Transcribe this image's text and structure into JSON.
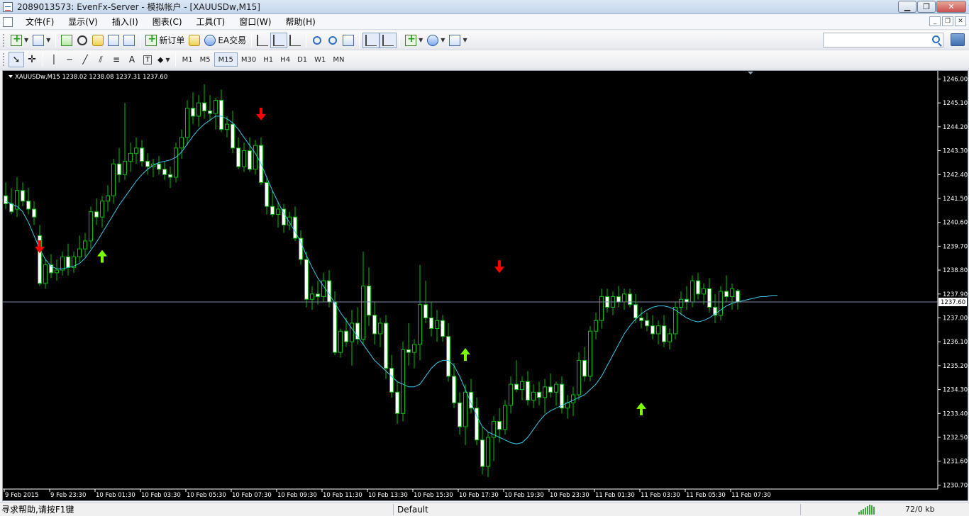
{
  "window": {
    "title": "2089013573: EvenFx-Server - 模拟帐户 - [XAUUSDw,M15]"
  },
  "menu": [
    {
      "label": "文件(F)"
    },
    {
      "label": "显示(V)"
    },
    {
      "label": "插入(I)"
    },
    {
      "label": "图表(C)"
    },
    {
      "label": "工具(T)"
    },
    {
      "label": "窗口(W)"
    },
    {
      "label": "帮助(H)"
    }
  ],
  "toolbar": {
    "new_order_label": "新订单",
    "ea_trading_label": "EA交易",
    "timeframes": [
      "M1",
      "M5",
      "M15",
      "M30",
      "H1",
      "H4",
      "D1",
      "W1",
      "MN"
    ],
    "active_timeframe": "M15",
    "search_placeholder": ""
  },
  "chart": {
    "header": "XAUUSDw,M15  1238.02 1238.08 1237.31 1237.60",
    "current_price_label": "1237.60",
    "colors": {
      "background": "#000000",
      "bull_body": "#000000",
      "bear_body": "#ffffff",
      "wick": "#00c000",
      "ma_line": "#40c8e8",
      "price_line": "#7a8fa8",
      "buy_arrow": "#7cfc00",
      "sell_arrow": "#ff0000",
      "axis_text": "#ffffff"
    },
    "x_labels": [
      "9 Feb 2015",
      "9 Feb 23:30",
      "10 Feb 01:30",
      "10 Feb 03:30",
      "10 Feb 05:30",
      "10 Feb 07:30",
      "10 Feb 09:30",
      "10 Feb 11:30",
      "10 Feb 13:30",
      "10 Feb 15:30",
      "10 Feb 17:30",
      "10 Feb 19:30",
      "10 Feb 23:30",
      "11 Feb 01:30",
      "11 Feb 03:30",
      "11 Feb 05:30",
      "11 Feb 07:30"
    ]
  },
  "chart_data": {
    "type": "candlestick",
    "symbol": "XAUUSDw",
    "timeframe": "M15",
    "last_bar": {
      "open": 1238.02,
      "high": 1238.08,
      "low": 1237.31,
      "close": 1237.6
    },
    "y_ticks": [
      1246.0,
      1245.1,
      1244.2,
      1243.3,
      1242.4,
      1241.5,
      1240.6,
      1239.7,
      1238.8,
      1237.9,
      1237.0,
      1236.1,
      1235.2,
      1234.3,
      1233.4,
      1232.5,
      1231.6,
      1230.7
    ],
    "ylim": [
      1230.55,
      1246.2
    ],
    "current_price": 1237.6,
    "series": [
      {
        "name": "",
        "type": "candles",
        "values": [
          [
            1241.6,
            1242.1,
            1241.1,
            1241.3
          ],
          [
            1241.3,
            1241.9,
            1240.9,
            1241.0
          ],
          [
            1241.1,
            1242.3,
            1240.8,
            1241.8
          ],
          [
            1241.8,
            1242.1,
            1241.2,
            1241.4
          ],
          [
            1241.4,
            1241.9,
            1240.9,
            1241.1
          ],
          [
            1241.1,
            1241.4,
            1240.5,
            1240.8
          ],
          [
            1240.1,
            1240.5,
            1238.2,
            1238.3
          ],
          [
            1238.3,
            1239.2,
            1238.1,
            1239.0
          ],
          [
            1239.0,
            1239.4,
            1238.5,
            1238.7
          ],
          [
            1238.7,
            1239.2,
            1238.4,
            1238.8
          ],
          [
            1238.8,
            1239.5,
            1238.6,
            1239.3
          ],
          [
            1239.3,
            1239.8,
            1238.6,
            1238.9
          ],
          [
            1238.9,
            1239.5,
            1238.7,
            1239.3
          ],
          [
            1239.3,
            1240.1,
            1239.1,
            1239.6
          ],
          [
            1239.6,
            1240.2,
            1239.3,
            1239.9
          ],
          [
            1239.9,
            1241.2,
            1239.6,
            1241.0
          ],
          [
            1241.0,
            1241.5,
            1240.5,
            1240.8
          ],
          [
            1240.8,
            1241.6,
            1240.4,
            1241.4
          ],
          [
            1241.4,
            1242.0,
            1241.0,
            1241.6
          ],
          [
            1241.6,
            1243.0,
            1241.3,
            1242.8
          ],
          [
            1242.8,
            1243.4,
            1242.1,
            1242.4
          ],
          [
            1242.4,
            1245.1,
            1242.2,
            1242.9
          ],
          [
            1242.9,
            1243.6,
            1242.5,
            1243.2
          ],
          [
            1243.2,
            1243.8,
            1242.8,
            1243.4
          ],
          [
            1243.4,
            1243.7,
            1242.7,
            1242.9
          ],
          [
            1242.9,
            1243.2,
            1242.4,
            1242.7
          ],
          [
            1242.7,
            1243.0,
            1242.3,
            1242.8
          ],
          [
            1242.8,
            1243.1,
            1242.4,
            1242.6
          ],
          [
            1242.6,
            1242.9,
            1242.2,
            1242.4
          ],
          [
            1242.4,
            1242.7,
            1241.9,
            1242.3
          ],
          [
            1242.3,
            1243.6,
            1242.1,
            1243.4
          ],
          [
            1243.4,
            1244.1,
            1243.0,
            1243.8
          ],
          [
            1243.8,
            1245.2,
            1243.5,
            1244.9
          ],
          [
            1244.9,
            1245.5,
            1244.3,
            1244.6
          ],
          [
            1244.6,
            1245.4,
            1244.2,
            1245.1
          ],
          [
            1245.1,
            1245.8,
            1244.5,
            1244.8
          ],
          [
            1244.8,
            1245.4,
            1244.4,
            1244.7
          ],
          [
            1244.7,
            1245.3,
            1244.1,
            1245.2
          ],
          [
            1245.2,
            1245.6,
            1244.0,
            1244.1
          ],
          [
            1244.1,
            1244.6,
            1243.8,
            1244.3
          ],
          [
            1244.3,
            1244.8,
            1243.2,
            1243.4
          ],
          [
            1243.4,
            1243.8,
            1242.6,
            1242.7
          ],
          [
            1242.7,
            1243.6,
            1242.5,
            1243.3
          ],
          [
            1243.3,
            1243.8,
            1242.5,
            1242.6
          ],
          [
            1242.6,
            1243.7,
            1242.4,
            1243.5
          ],
          [
            1243.5,
            1243.8,
            1242.0,
            1242.1
          ],
          [
            1242.1,
            1242.3,
            1240.9,
            1241.2
          ],
          [
            1241.2,
            1241.8,
            1240.8,
            1240.9
          ],
          [
            1240.9,
            1241.4,
            1240.4,
            1241.1
          ],
          [
            1241.1,
            1241.3,
            1240.2,
            1240.5
          ],
          [
            1240.5,
            1241.0,
            1240.3,
            1240.8
          ],
          [
            1240.8,
            1241.2,
            1239.9,
            1240.0
          ],
          [
            1240.0,
            1240.3,
            1239.0,
            1239.2
          ],
          [
            1239.2,
            1239.5,
            1237.4,
            1237.7
          ],
          [
            1237.7,
            1238.2,
            1237.3,
            1237.9
          ],
          [
            1237.9,
            1238.4,
            1237.5,
            1237.8
          ],
          [
            1237.8,
            1238.7,
            1237.6,
            1238.4
          ],
          [
            1238.4,
            1238.8,
            1237.4,
            1237.6
          ],
          [
            1237.6,
            1238.0,
            1235.6,
            1235.7
          ],
          [
            1235.7,
            1236.6,
            1235.5,
            1236.5
          ],
          [
            1236.5,
            1237.0,
            1235.9,
            1236.1
          ],
          [
            1236.1,
            1237.3,
            1235.2,
            1236.8
          ],
          [
            1236.8,
            1237.4,
            1236.0,
            1236.2
          ],
          [
            1236.2,
            1239.5,
            1236.0,
            1238.2
          ],
          [
            1238.2,
            1238.9,
            1236.7,
            1237.1
          ],
          [
            1237.1,
            1237.6,
            1236.0,
            1236.4
          ],
          [
            1236.4,
            1237.0,
            1235.9,
            1236.8
          ],
          [
            1236.8,
            1237.1,
            1234.7,
            1235.1
          ],
          [
            1235.1,
            1235.6,
            1234.0,
            1234.2
          ],
          [
            1234.2,
            1234.6,
            1233.0,
            1233.4
          ],
          [
            1233.4,
            1236.1,
            1233.1,
            1235.8
          ],
          [
            1235.8,
            1236.8,
            1235.2,
            1235.7
          ],
          [
            1235.7,
            1236.2,
            1235.1,
            1236.0
          ],
          [
            1236.0,
            1239.0,
            1235.4,
            1237.5
          ],
          [
            1237.5,
            1238.4,
            1236.8,
            1237.0
          ],
          [
            1237.0,
            1237.6,
            1236.3,
            1236.6
          ],
          [
            1236.6,
            1237.3,
            1236.1,
            1236.9
          ],
          [
            1236.9,
            1237.1,
            1236.1,
            1236.3
          ],
          [
            1236.3,
            1236.8,
            1234.6,
            1234.8
          ],
          [
            1234.8,
            1235.3,
            1233.6,
            1233.8
          ],
          [
            1233.8,
            1234.2,
            1232.6,
            1232.9
          ],
          [
            1232.9,
            1234.5,
            1232.2,
            1234.2
          ],
          [
            1234.2,
            1234.7,
            1233.4,
            1233.6
          ],
          [
            1233.6,
            1234.0,
            1232.2,
            1232.4
          ],
          [
            1232.4,
            1232.9,
            1231.1,
            1231.4
          ],
          [
            1231.4,
            1232.7,
            1231.0,
            1232.5
          ],
          [
            1232.5,
            1233.3,
            1231.6,
            1233.1
          ],
          [
            1233.1,
            1233.6,
            1232.3,
            1232.8
          ],
          [
            1232.8,
            1233.9,
            1232.6,
            1233.7
          ],
          [
            1233.7,
            1234.8,
            1233.4,
            1234.5
          ],
          [
            1234.5,
            1235.4,
            1234.2,
            1234.3
          ],
          [
            1234.3,
            1234.8,
            1233.9,
            1234.6
          ],
          [
            1234.6,
            1235.0,
            1233.7,
            1233.9
          ],
          [
            1233.9,
            1234.5,
            1233.6,
            1234.2
          ],
          [
            1234.2,
            1234.6,
            1233.7,
            1234.0
          ],
          [
            1234.0,
            1234.7,
            1233.4,
            1234.4
          ],
          [
            1234.4,
            1234.9,
            1234.0,
            1234.2
          ],
          [
            1234.2,
            1234.6,
            1233.7,
            1234.5
          ],
          [
            1234.5,
            1234.8,
            1233.4,
            1233.6
          ],
          [
            1233.6,
            1234.1,
            1233.2,
            1233.8
          ],
          [
            1233.8,
            1234.4,
            1233.3,
            1234.1
          ],
          [
            1234.1,
            1235.7,
            1233.9,
            1235.4
          ],
          [
            1235.4,
            1235.9,
            1234.6,
            1234.8
          ],
          [
            1234.8,
            1236.7,
            1234.6,
            1236.5
          ],
          [
            1236.5,
            1237.2,
            1236.2,
            1236.9
          ],
          [
            1236.9,
            1238.1,
            1236.6,
            1237.8
          ],
          [
            1237.8,
            1238.1,
            1237.2,
            1237.4
          ],
          [
            1237.4,
            1238.0,
            1237.1,
            1237.8
          ],
          [
            1237.8,
            1238.2,
            1237.4,
            1237.6
          ],
          [
            1237.6,
            1238.1,
            1237.3,
            1237.9
          ],
          [
            1237.9,
            1238.1,
            1237.4,
            1237.5
          ],
          [
            1237.5,
            1237.9,
            1236.8,
            1237.0
          ],
          [
            1237.0,
            1237.4,
            1236.6,
            1236.9
          ],
          [
            1236.9,
            1237.2,
            1236.5,
            1236.7
          ],
          [
            1236.7,
            1237.1,
            1236.2,
            1236.4
          ],
          [
            1236.4,
            1236.9,
            1236.0,
            1236.7
          ],
          [
            1236.7,
            1237.1,
            1235.9,
            1236.1
          ],
          [
            1236.1,
            1236.6,
            1235.8,
            1236.4
          ],
          [
            1236.4,
            1237.6,
            1236.2,
            1237.4
          ],
          [
            1237.4,
            1238.0,
            1237.1,
            1237.7
          ],
          [
            1237.7,
            1238.2,
            1237.3,
            1237.6
          ],
          [
            1237.6,
            1238.6,
            1237.4,
            1238.4
          ],
          [
            1238.4,
            1238.7,
            1237.7,
            1237.9
          ],
          [
            1237.9,
            1238.3,
            1237.5,
            1238.1
          ],
          [
            1238.1,
            1238.5,
            1237.2,
            1237.4
          ],
          [
            1237.4,
            1237.9,
            1236.8,
            1237.1
          ],
          [
            1237.1,
            1238.2,
            1236.9,
            1238.0
          ],
          [
            1238.0,
            1238.6,
            1237.6,
            1237.8
          ],
          [
            1237.8,
            1238.3,
            1237.3,
            1238.1
          ],
          [
            1238.02,
            1238.08,
            1237.31,
            1237.6
          ]
        ]
      },
      {
        "name": "",
        "type": "line",
        "values": [
          1241.4,
          1241.3,
          1241.2,
          1241.0,
          1240.6,
          1240.1,
          1239.6,
          1239.2,
          1238.95,
          1238.85,
          1238.85,
          1238.9,
          1238.95,
          1239.05,
          1239.25,
          1239.55,
          1239.85,
          1240.2,
          1240.55,
          1240.9,
          1241.25,
          1241.55,
          1241.85,
          1242.15,
          1242.4,
          1242.6,
          1242.75,
          1242.85,
          1242.9,
          1242.95,
          1243.05,
          1243.25,
          1243.55,
          1243.85,
          1244.1,
          1244.3,
          1244.45,
          1244.6,
          1244.6,
          1244.5,
          1244.35,
          1244.1,
          1243.8,
          1243.5,
          1243.2,
          1242.8,
          1242.3,
          1241.8,
          1241.35,
          1240.95,
          1240.6,
          1240.25,
          1239.85,
          1239.35,
          1238.9,
          1238.5,
          1238.2,
          1237.9,
          1237.55,
          1237.2,
          1236.9,
          1236.6,
          1236.3,
          1236.0,
          1235.7,
          1235.4,
          1235.2,
          1235.0,
          1234.8,
          1234.6,
          1234.5,
          1234.4,
          1234.4,
          1234.5,
          1234.8,
          1235.1,
          1235.3,
          1235.4,
          1235.4,
          1235.2,
          1234.8,
          1234.3,
          1233.8,
          1233.3,
          1232.9,
          1232.7,
          1232.6,
          1232.5,
          1232.4,
          1232.3,
          1232.25,
          1232.3,
          1232.5,
          1232.8,
          1233.1,
          1233.35,
          1233.5,
          1233.6,
          1233.7,
          1233.8,
          1233.9,
          1234.0,
          1234.1,
          1234.3,
          1234.5,
          1234.8,
          1235.2,
          1235.6,
          1236.0,
          1236.4,
          1236.7,
          1236.95,
          1237.15,
          1237.3,
          1237.4,
          1237.45,
          1237.45,
          1237.4,
          1237.3,
          1237.15,
          1237.0,
          1236.9,
          1236.85,
          1236.9,
          1237.0,
          1237.15,
          1237.3,
          1237.45,
          1237.55,
          1237.6,
          1237.65,
          1237.7,
          1237.75,
          1237.8,
          1237.8,
          1237.85,
          1237.85
        ]
      }
    ],
    "signals": [
      {
        "type": "sell",
        "bar": 6,
        "price": 1239.6
      },
      {
        "type": "buy",
        "bar": 17,
        "price": 1239.4
      },
      {
        "type": "sell",
        "bar": 45,
        "price": 1244.6
      },
      {
        "type": "buy",
        "bar": 81,
        "price": 1235.7
      },
      {
        "type": "sell",
        "bar": 87,
        "price": 1238.85
      },
      {
        "type": "buy",
        "bar": 112,
        "price": 1233.65
      }
    ]
  },
  "status": {
    "help_text": "寻求帮助,请按F1键",
    "profile": "Default",
    "traffic": "72/0 kb"
  }
}
